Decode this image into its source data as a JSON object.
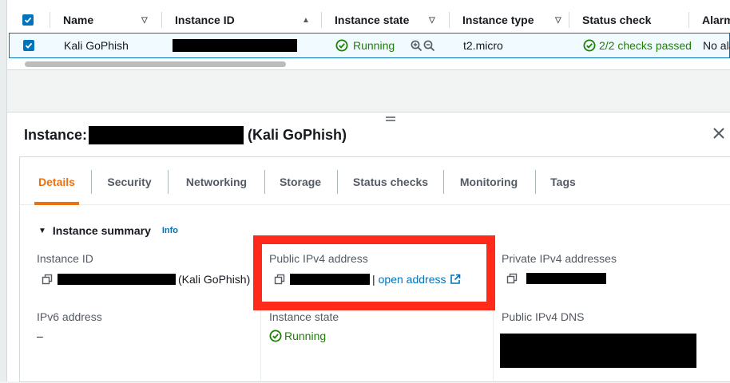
{
  "table": {
    "columns": [
      {
        "label": "Name",
        "sort": "▽"
      },
      {
        "label": "Instance ID",
        "sort": "▲"
      },
      {
        "label": "Instance state",
        "sort": "▽"
      },
      {
        "label": "Instance type",
        "sort": "▽"
      },
      {
        "label": "Status check",
        "sort": ""
      },
      {
        "label": "Alarm",
        "sort": ""
      }
    ],
    "row": {
      "name": "Kali GoPhish",
      "instance_state": "Running",
      "instance_type": "t2.micro",
      "status_check": "2/2 checks passed",
      "alarm": "No ala"
    }
  },
  "panel": {
    "title_prefix": "Instance:",
    "title_suffix": "(Kali GoPhish)",
    "tabs": [
      "Details",
      "Security",
      "Networking",
      "Storage",
      "Status checks",
      "Monitoring",
      "Tags"
    ],
    "active_tab": "Details",
    "summary_title": "Instance summary",
    "info_label": "Info",
    "fields": {
      "instance_id_label": "Instance ID",
      "instance_id_suffix": "(Kali GoPhish)",
      "public_ipv4_label": "Public IPv4 address",
      "separator": "|",
      "open_address": "open address",
      "private_ipv4_label": "Private IPv4 addresses",
      "ipv6_label": "IPv6 address",
      "ipv6_value": "–",
      "instance_state_label": "Instance state",
      "instance_state_value": "Running",
      "public_dns_label": "Public IPv4 DNS"
    }
  },
  "colors": {
    "accent": "#0073bb",
    "active_tab": "#ec7211",
    "success": "#1d8102",
    "highlight": "#ff2a1a"
  },
  "icons": [
    "checkbox-icon",
    "sort-icon",
    "success-icon",
    "zoom-in-icon",
    "zoom-out-icon",
    "close-icon",
    "copy-icon",
    "external-link-icon",
    "caret-down-icon",
    "drag-handle-icon"
  ]
}
